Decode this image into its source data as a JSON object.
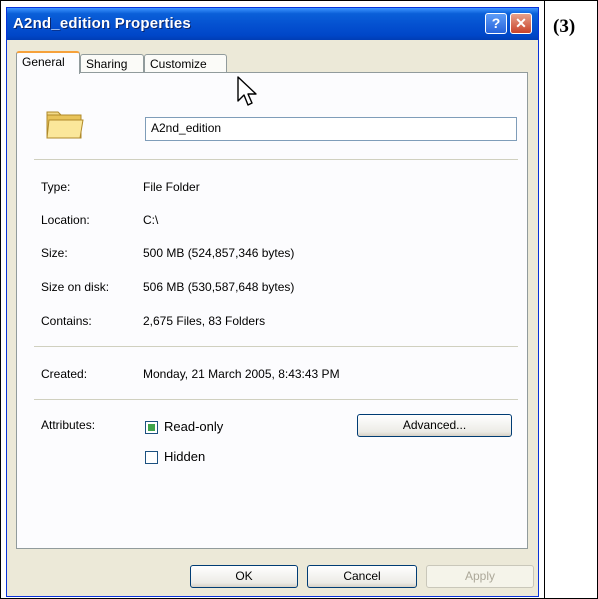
{
  "figure_label": "(3)",
  "window": {
    "title": "A2nd_edition Properties",
    "help_glyph": "?",
    "close_glyph": "✕"
  },
  "tabs": [
    {
      "label": "General",
      "active": true
    },
    {
      "label": "Sharing",
      "active": false
    },
    {
      "label": "Customize",
      "active": false
    }
  ],
  "general": {
    "folder_name": "A2nd_edition",
    "type": {
      "label": "Type:",
      "value": "File Folder"
    },
    "location": {
      "label": "Location:",
      "value": "C:\\"
    },
    "size": {
      "label": "Size:",
      "value": "500 MB (524,857,346 bytes)"
    },
    "size_on_disk": {
      "label": "Size on disk:",
      "value": "506 MB (530,587,648 bytes)"
    },
    "contains": {
      "label": "Contains:",
      "value": "2,675 Files, 83 Folders"
    },
    "created": {
      "label": "Created:",
      "value": "Monday, 21 March 2005, 8:43:43 PM"
    },
    "attributes": {
      "label": "Attributes:",
      "read_only": {
        "label": "Read-only",
        "checked": true
      },
      "hidden": {
        "label": "Hidden",
        "checked": false
      },
      "advanced_label": "Advanced..."
    }
  },
  "footer": {
    "ok_label": "OK",
    "cancel_label": "Cancel",
    "apply_label": "Apply"
  },
  "colors": {
    "titlebar": "#0450d0",
    "dialog_bg": "#ece9d8",
    "active_tab_accent": "#f6a13a",
    "checkbox_fill": "#3fa44a"
  }
}
